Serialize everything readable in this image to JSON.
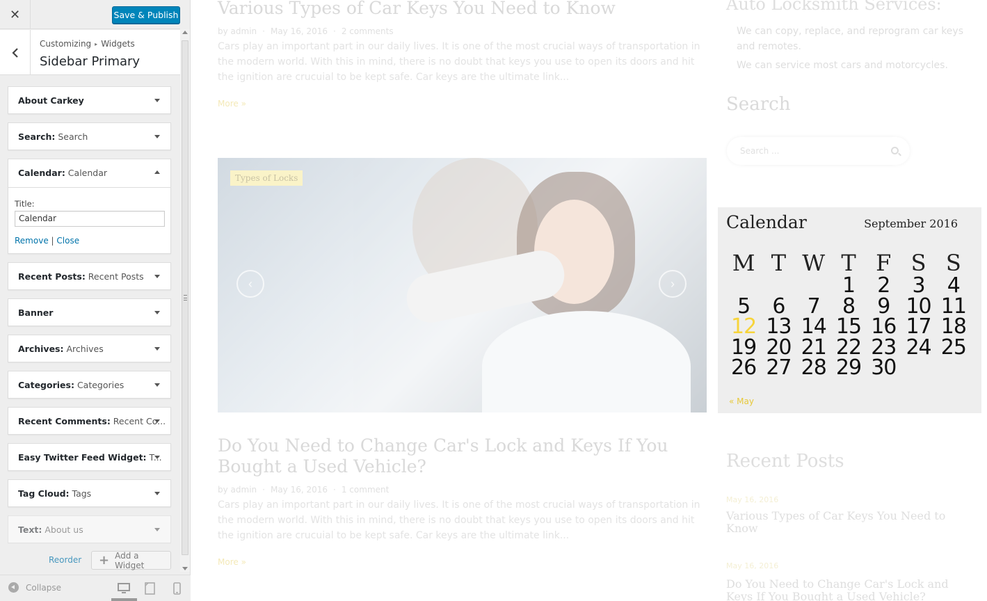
{
  "sidebar": {
    "close_label": "✕",
    "publish_label": "Save & Publish",
    "breadcrumb": [
      "Customizing",
      "Widgets"
    ],
    "breadcrumb_sep": "▸",
    "section_title": "Sidebar Primary",
    "widgets": [
      {
        "title": "About Carkey",
        "sub": ""
      },
      {
        "title": "Search:",
        "sub": " Search"
      },
      {
        "title": "Calendar:",
        "sub": " Calendar"
      },
      {
        "title": "Recent Posts:",
        "sub": " Recent Posts"
      },
      {
        "title": "Banner",
        "sub": ""
      },
      {
        "title": "Archives:",
        "sub": " Archives"
      },
      {
        "title": "Categories:",
        "sub": " Categories"
      },
      {
        "title": "Recent Comments:",
        "sub": " Recent Co..."
      },
      {
        "title": "Easy Twitter Feed Widget:",
        "sub": " T..."
      },
      {
        "title": "Tag Cloud:",
        "sub": " Tags"
      },
      {
        "title": "Text:",
        "sub": " About us"
      }
    ],
    "calendar_widget": {
      "title_label": "Title:",
      "title_value": "Calendar",
      "remove_label": "Remove",
      "separator": "|",
      "close_label": "Close"
    },
    "reorder_label": "Reorder",
    "add_widget_label": "Add a Widget",
    "collapse_label": "Collapse"
  },
  "preview": {
    "post1": {
      "title": "Various Types of Car Keys You Need to Know",
      "author": "by admin",
      "date": "May 16, 2016",
      "comments": "2 comments",
      "excerpt": "Cars play an important part in our daily lives. It is one of the most crucial ways of transportation in the modern world. With this in mind, there is no doubt that keys you use to open its doors and hit the ignition are crucuial to be kept safe. Car keys are the ultimate link...",
      "more": "More »"
    },
    "hero_tag": "Types of Locks",
    "post2": {
      "title": "Do You Need to Change Car's Lock and Keys If You Bought a Used Vehicle?",
      "author": "by admin",
      "date": "May 16, 2016",
      "comments": "1 comment",
      "excerpt": "Cars play an important part in our daily lives. It is one of the most crucial ways of transportation in the modern world. With this in mind, there is no doubt that keys you use to open its doors and hit the ignition are crucuial to be kept safe. Car keys are the ultimate link...",
      "more": "More »"
    },
    "services": {
      "title": "Auto Locksmith Services:",
      "line1": "We can copy, replace, and reprogram car keys",
      "line2": "and remotes.",
      "line3": "We can service most cars and motorcycles."
    },
    "search": {
      "title": "Search",
      "placeholder": "Search ..."
    },
    "calendar": {
      "title": "Calendar",
      "month": "September 2016",
      "headers": [
        "M",
        "T",
        "W",
        "T",
        "F",
        "S",
        "S"
      ],
      "leading_blanks": 3,
      "days": [
        "1",
        "2",
        "3",
        "4",
        "5",
        "6",
        "7",
        "8",
        "9",
        "10",
        "11",
        "12",
        "13",
        "14",
        "15",
        "16",
        "17",
        "18",
        "19",
        "20",
        "21",
        "22",
        "23",
        "24",
        "25",
        "26",
        "27",
        "28",
        "29",
        "30"
      ],
      "today": "12",
      "prev_link": "« May"
    },
    "recent_posts": {
      "title": "Recent Posts",
      "items": [
        {
          "date": "May 16, 2016",
          "title": "Various Types of Car Keys You Need to Know"
        },
        {
          "date": "May 16, 2016",
          "title": "Do You Need to Change Car's Lock and Keys If You Bought a Used Vehicle?"
        }
      ]
    },
    "colors": {
      "accent": "#f7d43a",
      "publish": "#0085ba",
      "link": "#0073aa"
    }
  }
}
